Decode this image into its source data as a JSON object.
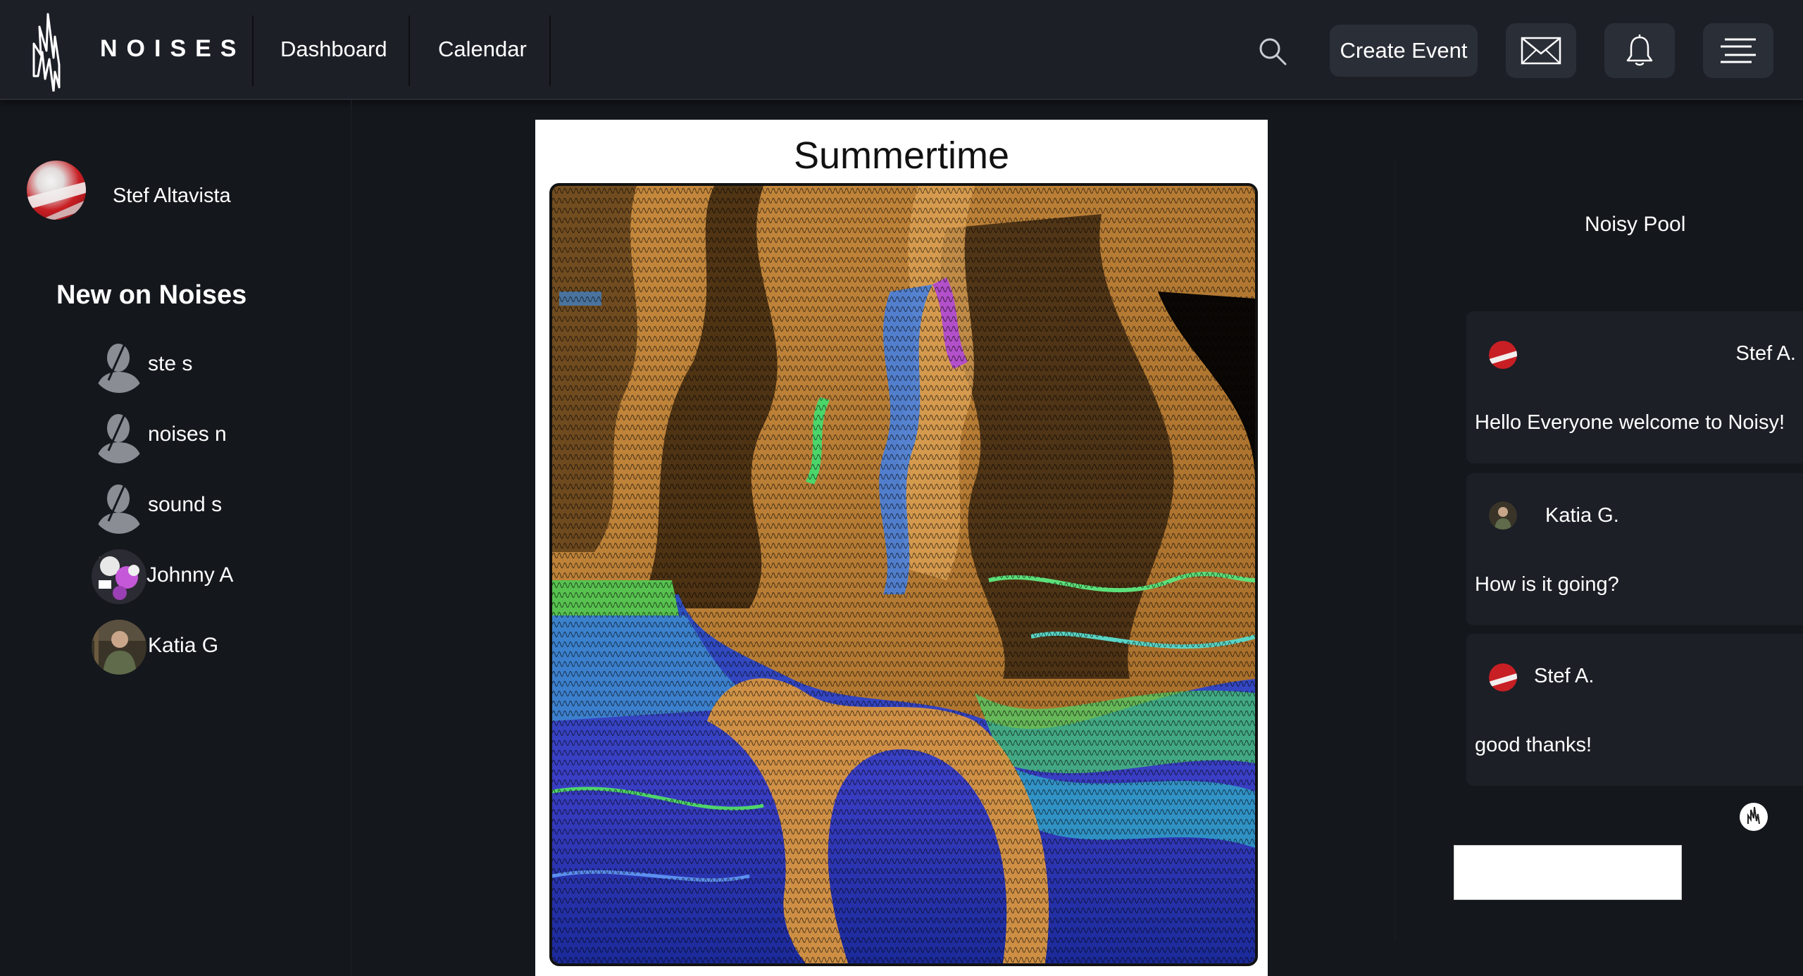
{
  "header": {
    "brand": "NOISES",
    "nav": [
      "Dashboard",
      "Calendar"
    ],
    "create_event_label": "Create Event"
  },
  "sidebar": {
    "user_name": "Stef Altavista",
    "section_title": "New on Noises",
    "members": [
      {
        "name": "ste s"
      },
      {
        "name": "noises n"
      },
      {
        "name": "sound s"
      },
      {
        "name": "Johnny A"
      },
      {
        "name": "Katia G"
      }
    ]
  },
  "post": {
    "title": "Summertime"
  },
  "chat": {
    "title": "Noisy Pool",
    "messages": [
      {
        "author": "Stef A.",
        "text": "Hello Everyone welcome to Noisy!"
      },
      {
        "author": "Katia G.",
        "text": "How is it going?"
      },
      {
        "author": "Stef A.",
        "text": "good thanks!"
      }
    ],
    "input_value": ""
  },
  "colors": {
    "background": "#14171c",
    "topbar": "#1c1f26",
    "button": "#2a2e37",
    "art_orange": "#e3a14e",
    "art_blue": "#3b64d6",
    "art_green": "#4fd46a"
  }
}
